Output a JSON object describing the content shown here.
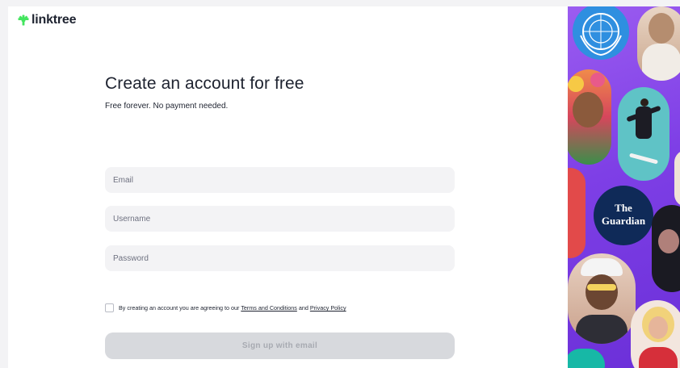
{
  "brand": {
    "name": "linktree",
    "icon": "linktree-asterisk-icon",
    "color": "#43e55e"
  },
  "form": {
    "title": "Create an account for free",
    "subtitle": "Free forever. No payment needed.",
    "email_placeholder": "Email",
    "username_placeholder": "Username",
    "password_placeholder": "Password",
    "consent_prefix": "By creating an account you are agreeing to our",
    "terms_link": "Terms and Conditions",
    "consent_and": "and",
    "privacy_link": "Privacy Policy",
    "submit_label": "Sign up with email"
  },
  "side_panel": {
    "guardian_logo": "The Guardian",
    "accent": "#8448ec"
  }
}
